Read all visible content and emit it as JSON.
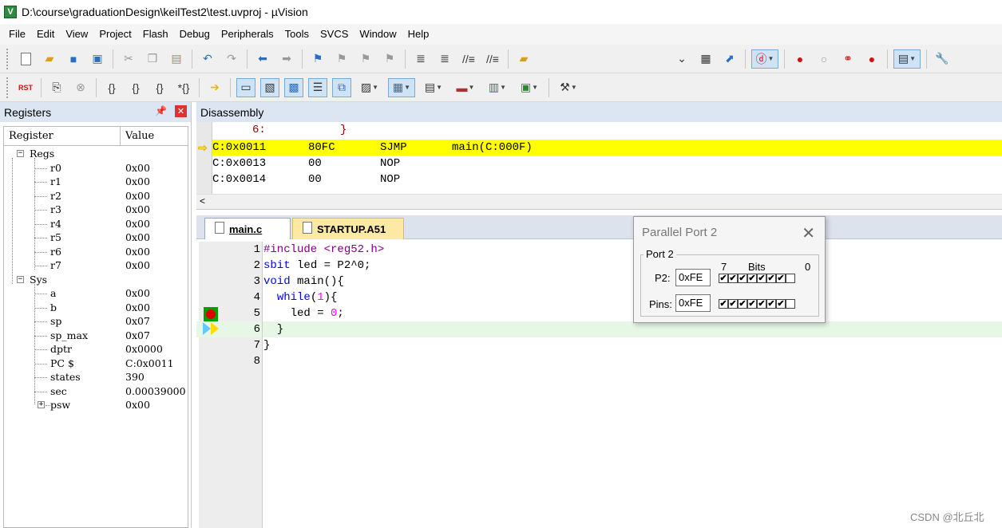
{
  "window": {
    "title": "D:\\course\\graduationDesign\\keilTest2\\test.uvproj - µVision",
    "app_icon": "V"
  },
  "menu": [
    "File",
    "Edit",
    "View",
    "Project",
    "Flash",
    "Debug",
    "Peripherals",
    "Tools",
    "SVCS",
    "Window",
    "Help"
  ],
  "registers": {
    "title": "Registers",
    "col_register": "Register",
    "col_value": "Value",
    "group_regs": "Regs",
    "group_sys": "Sys",
    "regs": [
      {
        "name": "r0",
        "value": "0x00"
      },
      {
        "name": "r1",
        "value": "0x00"
      },
      {
        "name": "r2",
        "value": "0x00"
      },
      {
        "name": "r3",
        "value": "0x00"
      },
      {
        "name": "r4",
        "value": "0x00"
      },
      {
        "name": "r5",
        "value": "0x00"
      },
      {
        "name": "r6",
        "value": "0x00"
      },
      {
        "name": "r7",
        "value": "0x00"
      }
    ],
    "sys": [
      {
        "name": "a",
        "value": "0x00"
      },
      {
        "name": "b",
        "value": "0x00"
      },
      {
        "name": "sp",
        "value": "0x07"
      },
      {
        "name": "sp_max",
        "value": "0x07"
      },
      {
        "name": "dptr",
        "value": "0x0000"
      },
      {
        "name": "PC  $",
        "value": "C:0x0011"
      },
      {
        "name": "states",
        "value": "390"
      },
      {
        "name": "sec",
        "value": "0.00039000"
      },
      {
        "name": "psw",
        "value": "0x00"
      }
    ]
  },
  "disassembly": {
    "title": "Disassembly",
    "lines": [
      {
        "addr": "     6:",
        "code": "",
        "mnem": "",
        "operand": "}",
        "current": false
      },
      {
        "addr": "C:0x0011",
        "code": "80FC",
        "mnem": "SJMP",
        "operand": "main(C:000F)",
        "current": true
      },
      {
        "addr": "C:0x0013",
        "code": "00",
        "mnem": "NOP",
        "operand": "",
        "current": false
      },
      {
        "addr": "C:0x0014",
        "code": "00",
        "mnem": "NOP",
        "operand": "",
        "current": false
      }
    ],
    "scroll_left": "<"
  },
  "editor": {
    "tabs": [
      {
        "label": "main.c",
        "active": true
      },
      {
        "label": "STARTUP.A51",
        "active": false
      }
    ],
    "lines": [
      {
        "n": "1"
      },
      {
        "n": "2"
      },
      {
        "n": "3"
      },
      {
        "n": "4"
      },
      {
        "n": "5"
      },
      {
        "n": "6"
      },
      {
        "n": "7"
      },
      {
        "n": "8"
      }
    ],
    "code": {
      "l1_pp": "#include",
      "l1_str": " <reg52.h>",
      "l2_kw": "sbit",
      "l2_rest": " led = P2^0;",
      "l3_kw": "void",
      "l3_rest": " main(){",
      "l4_indent": "  ",
      "l4_kw": "while",
      "l4_p1": "(",
      "l4_num": "1",
      "l4_p2": "){",
      "l5_rest": "    led = ",
      "l5_num": "0",
      "l5_end": ";",
      "l6": "  }",
      "l7": "}"
    }
  },
  "parallel_port": {
    "title": "Parallel Port 2",
    "close": "✕",
    "group": "Port 2",
    "bit_high": "7",
    "bits_label": "Bits",
    "bit_low": "0",
    "p2_label": "P2:",
    "p2_value": "0xFE",
    "pins_label": "Pins:",
    "pins_value": "0xFE",
    "p2_bits": [
      true,
      true,
      true,
      true,
      true,
      true,
      true,
      false
    ],
    "pins_bits": [
      true,
      true,
      true,
      true,
      true,
      true,
      true,
      false
    ]
  },
  "watermark": "CSDN @北丘北"
}
